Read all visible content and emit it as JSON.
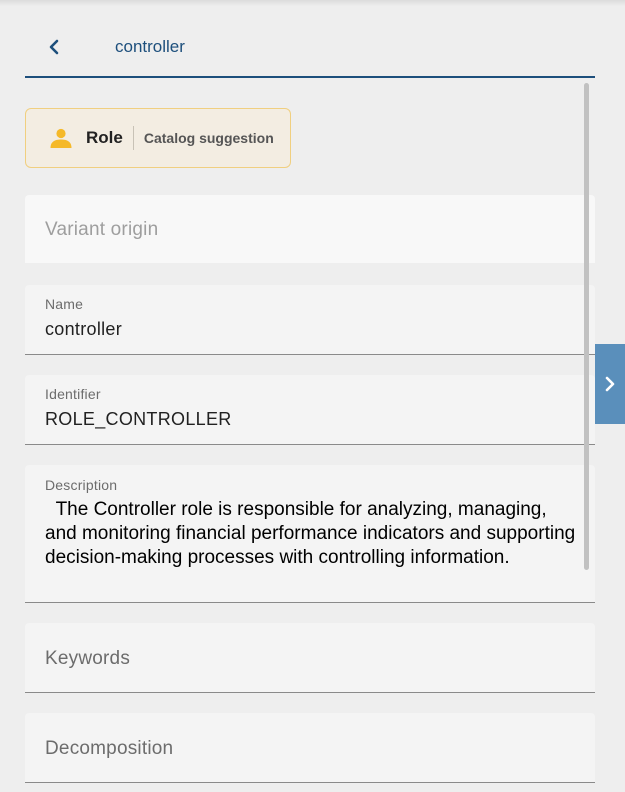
{
  "header": {
    "back_icon": "chevron-left-icon",
    "title": "controller"
  },
  "chip": {
    "icon": "person-icon",
    "icon_color": "#f5b929",
    "type": "Role",
    "subtitle": "Catalog suggestion"
  },
  "fields": {
    "variant_origin": {
      "placeholder": "Variant origin"
    },
    "name": {
      "label": "Name",
      "value": "controller"
    },
    "identifier": {
      "label": "Identifier",
      "value": "ROLE_CONTROLLER"
    },
    "description": {
      "label": "Description",
      "value": "  The Controller role is responsible for analyzing, managing, and monitoring financial performance indicators and supporting decision-making processes with controlling information."
    },
    "keywords": {
      "placeholder": "Keywords"
    },
    "decomposition": {
      "placeholder": "Decomposition"
    }
  },
  "side_panel_toggle": {
    "icon": "chevron-right-icon"
  },
  "colors": {
    "accent": "#1d4f7c",
    "toggle": "#5a8fbb",
    "chip_border": "#f0cf80"
  }
}
